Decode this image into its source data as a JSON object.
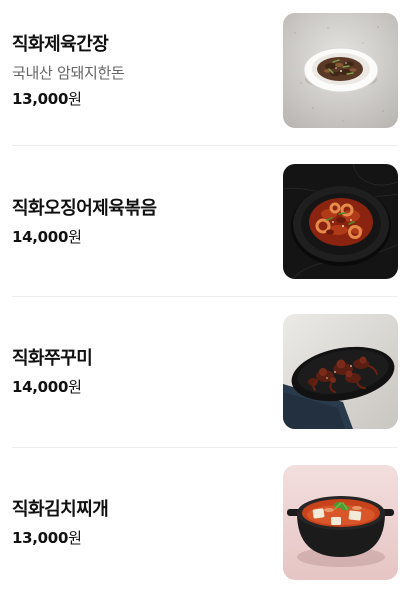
{
  "menu": {
    "items": [
      {
        "name": "직화제육간장",
        "description": "국내산 암돼지한돈",
        "price": "13,000",
        "currency": "원",
        "image": "stir-fried-pork-bowl"
      },
      {
        "name": "직화오징어제육볶음",
        "price": "14,000",
        "currency": "원",
        "image": "spicy-squid-pork-plate"
      },
      {
        "name": "직화쭈꾸미",
        "price": "14,000",
        "currency": "원",
        "image": "spicy-webfoot-octopus-plate"
      },
      {
        "name": "직화김치찌개",
        "price": "13,000",
        "currency": "원",
        "image": "kimchi-stew-pot"
      }
    ]
  },
  "colors": {
    "text": "#111111",
    "subtext": "#666666",
    "divider": "#eeeeee"
  }
}
